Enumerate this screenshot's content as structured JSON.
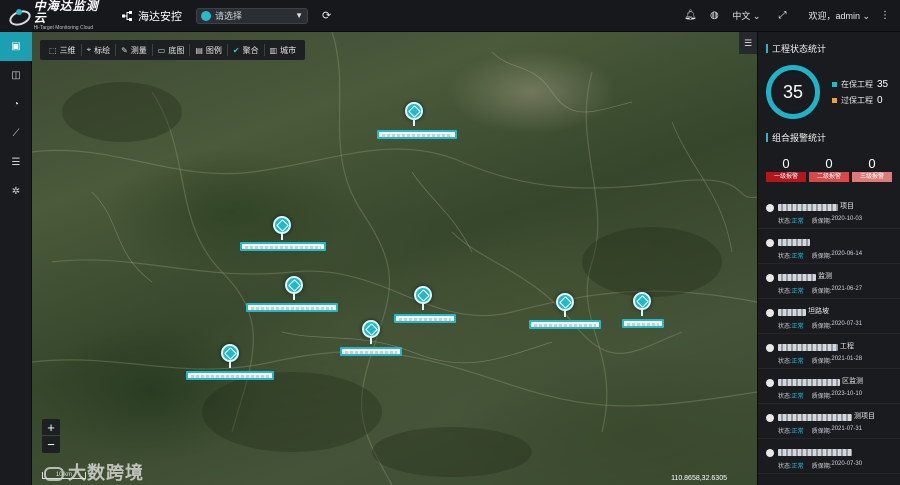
{
  "app": {
    "logo_main": "中海达监测云",
    "logo_sub": "Hi-Target Monitoring Cloud",
    "module_name": "海达安控",
    "select_placeholder": "请选择",
    "language": "中文",
    "welcome": "欢迎，admin"
  },
  "toolbar": {
    "items": [
      {
        "icon": "3d-icon",
        "label": "三维"
      },
      {
        "icon": "marker-icon",
        "label": "标绘"
      },
      {
        "icon": "ruler-icon",
        "label": "测量"
      },
      {
        "icon": "basemap-icon",
        "label": "底图"
      },
      {
        "icon": "legend-icon",
        "label": "图例"
      },
      {
        "icon": "check-icon",
        "label": "聚合"
      },
      {
        "icon": "city-icon",
        "label": "城市"
      }
    ]
  },
  "map": {
    "coords": "110.8658,32.6305",
    "scale": "10 km",
    "watermark": "大数跨境",
    "zoom_in": "+",
    "zoom_out": "−",
    "markers": [
      {
        "suffix": "项目"
      },
      {
        "suffix": "村"
      },
      {
        "suffix": "往路"
      },
      {
        "suffix": ""
      },
      {
        "suffix": ""
      },
      {
        "suffix": ""
      },
      {
        "suffix": ""
      },
      {
        "suffix": "村"
      }
    ]
  },
  "panel": {
    "status_title": "工程状态统计",
    "total": "35",
    "in_warranty_label": "在保工程",
    "in_warranty_count": "35",
    "out_warranty_label": "过保工程",
    "out_warranty_count": "0",
    "alarm_title": "组合报警统计",
    "alarms": [
      {
        "count": "0",
        "label": "一级报警",
        "color": "#b3161b"
      },
      {
        "count": "0",
        "label": "二级报警",
        "color": "#d94848"
      },
      {
        "count": "0",
        "label": "三级报警",
        "color": "#e07a7a"
      }
    ],
    "colors": {
      "accent": "#23b8ca",
      "in_warranty": "#23b8ca",
      "out_warranty": "#e8a33a"
    },
    "projects": [
      {
        "suffix": "项目",
        "status_label": "状态:",
        "status": "正常",
        "warranty_label": "质保期:",
        "warranty": "2020-10-03"
      },
      {
        "suffix": "",
        "status_label": "状态:",
        "status": "正常",
        "warranty_label": "质保期:",
        "warranty": "2020-06-14"
      },
      {
        "suffix": "监测",
        "status_label": "状态:",
        "status": "正常",
        "warranty_label": "质保期:",
        "warranty": "2021-06-27"
      },
      {
        "suffix": "坦路坡",
        "status_label": "状态:",
        "status": "正常",
        "warranty_label": "质保期:",
        "warranty": "2020-07-31"
      },
      {
        "suffix": "工程",
        "status_label": "状态:",
        "status": "正常",
        "warranty_label": "质保期:",
        "warranty": "2021-01-28"
      },
      {
        "suffix": "区监测",
        "status_label": "状态:",
        "status": "正常",
        "warranty_label": "质保期:",
        "warranty": "2023-10-10"
      },
      {
        "suffix": "测项目",
        "status_label": "状态:",
        "status": "正常",
        "warranty_label": "质保期:",
        "warranty": "2021-07-31"
      },
      {
        "suffix": "",
        "status_label": "状态:",
        "status": "正常",
        "warranty_label": "质保期:",
        "warranty": "2020-07-30"
      }
    ]
  }
}
